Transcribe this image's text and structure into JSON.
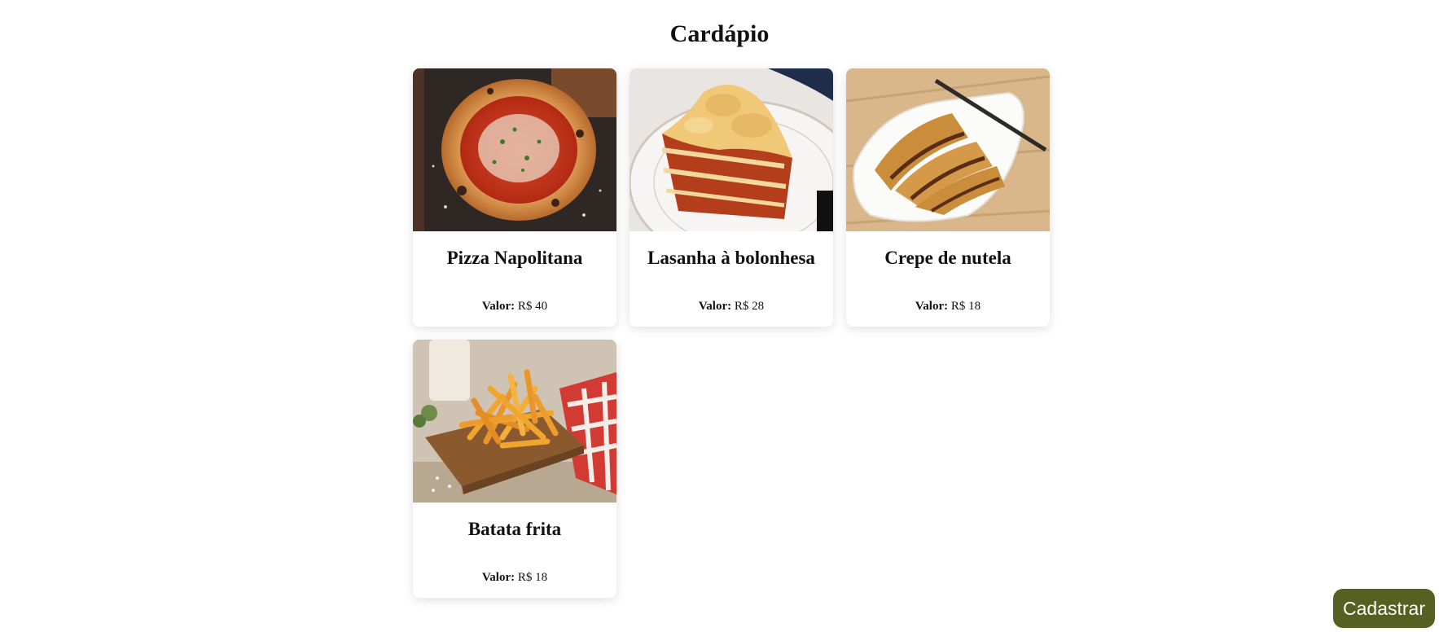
{
  "page": {
    "title": "Cardápio"
  },
  "menu": {
    "items": [
      {
        "name": "Pizza Napolitana",
        "price_label": "Valor:",
        "price": "R$ 40",
        "image": "pizza-image"
      },
      {
        "name": "Lasanha à bolonhesa",
        "price_label": "Valor:",
        "price": "R$ 28",
        "image": "lasagna-image"
      },
      {
        "name": "Crepe de nutela",
        "price_label": "Valor:",
        "price": "R$ 18",
        "image": "crepe-image"
      },
      {
        "name": "Batata frita",
        "price_label": "Valor:",
        "price": "R$ 18",
        "image": "fries-image"
      }
    ]
  },
  "actions": {
    "register_label": "Cadastrar"
  },
  "colors": {
    "register_button": "#556021",
    "card_background": "#ffffff"
  }
}
